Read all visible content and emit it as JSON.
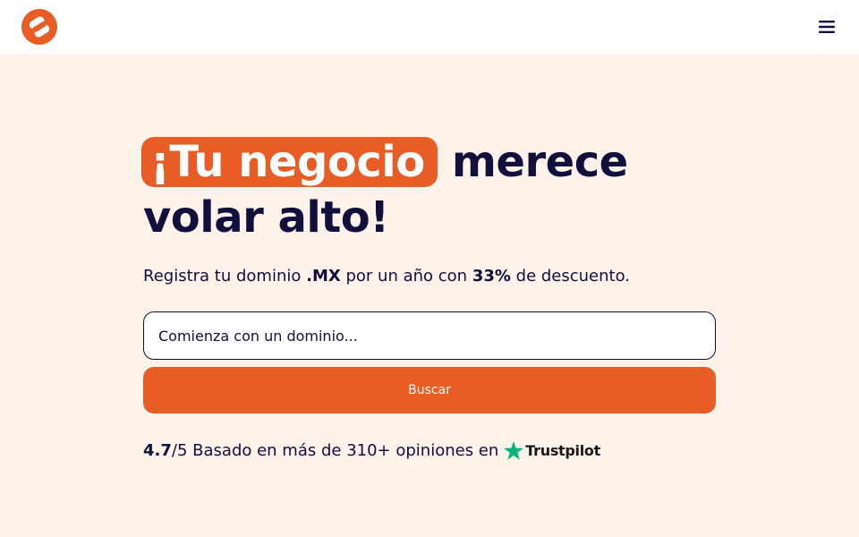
{
  "colors": {
    "brand": "#e85c26",
    "text": "#120f3d",
    "background": "#fdf3ea",
    "trustpilot_star": "#00b67a"
  },
  "header": {
    "logo_icon": "brand-logo-icon",
    "menu_icon": "hamburger-menu-icon"
  },
  "hero": {
    "headline_highlight": "¡Tu negocio",
    "headline_rest": "merece volar alto!",
    "subtitle_pre": "Registra tu dominio",
    "subtitle_tld": ".MX",
    "subtitle_mid": "por un año con",
    "subtitle_discount": "33%",
    "subtitle_post": "de descuento."
  },
  "search": {
    "placeholder": "Comienza con un dominio...",
    "button_label": "Buscar"
  },
  "rating": {
    "score": "4.7",
    "scale": "/5",
    "text": "Basado en más de 310+ opiniones en",
    "provider": "Trustpilot",
    "star_icon": "trustpilot-star-icon"
  }
}
